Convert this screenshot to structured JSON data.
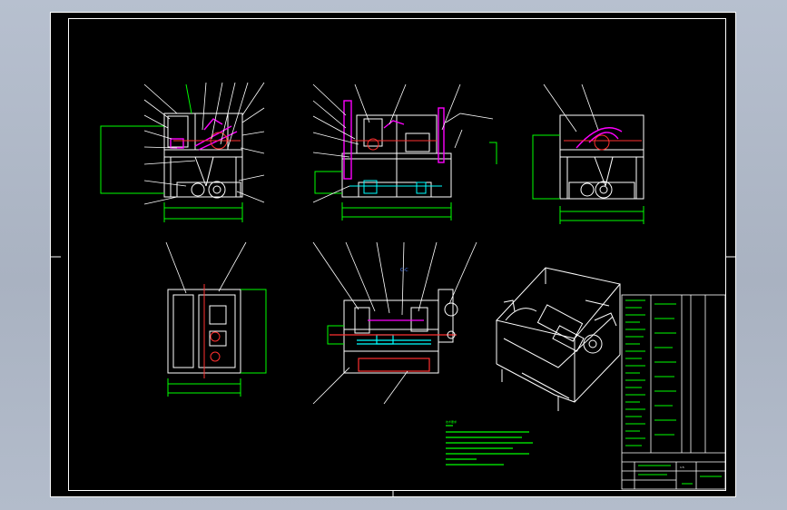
{
  "viewer": {
    "background": "#adb6c6",
    "sheet_background": "#000000"
  },
  "drawing": {
    "view_marker": "C-C",
    "notes_title": "技术要求",
    "colors": {
      "frame": "#ffffff",
      "dimension": "#00ff00",
      "part": "#ff00ff",
      "hidden": "#ff3030",
      "text": "#ffff00",
      "cyan": "#00ffff",
      "blue": "#4a7dff"
    }
  },
  "title_block": {
    "scale": "1:5",
    "material": "",
    "drawing_no": ""
  }
}
